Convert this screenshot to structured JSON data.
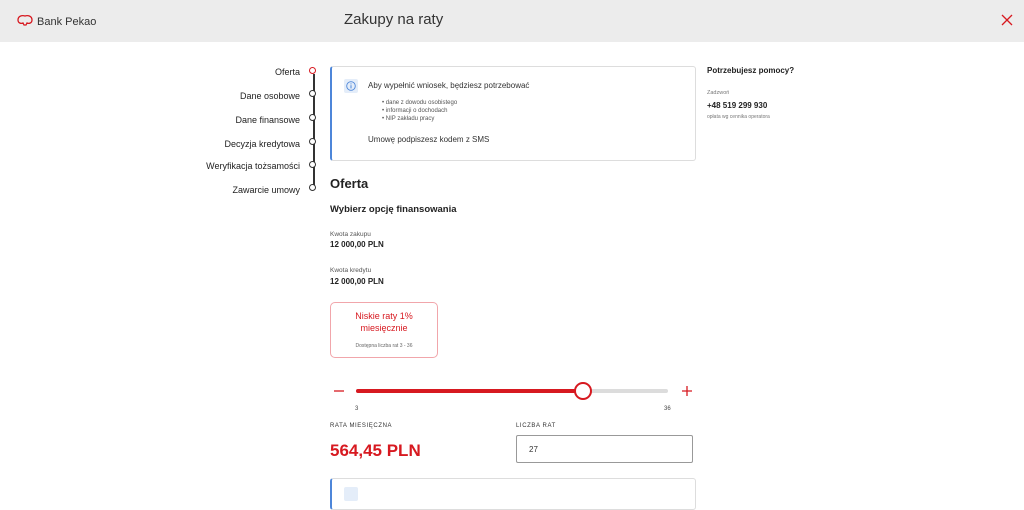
{
  "header": {
    "brand": "Bank Pekao",
    "title": "Zakupy na raty"
  },
  "colors": {
    "accent": "#d71920",
    "info": "#4d86d9",
    "header_bg": "#ececec"
  },
  "steps": [
    {
      "label": "Oferta",
      "active": true
    },
    {
      "label": "Dane osobowe",
      "active": false
    },
    {
      "label": "Dane finansowe",
      "active": false
    },
    {
      "label": "Decyzja kredytowa",
      "active": false
    },
    {
      "label": "Weryfikacja tożsamości",
      "active": false
    },
    {
      "label": "Zawarcie umowy",
      "active": false
    }
  ],
  "info": {
    "title": "Aby wypełnić wniosek, będziesz potrzebować",
    "items": [
      "dane z dowodu osobistego",
      "informacji o dochodach",
      "NIP zakładu pracy"
    ],
    "footer": "Umowę podpiszesz kodem z SMS"
  },
  "offer": {
    "title": "Oferta",
    "subtitle": "Wybierz opcję finansowania",
    "purchase_label": "Kwota zakupu",
    "purchase_value": "12 000,00 PLN",
    "credit_label": "Kwota kredytu",
    "credit_value": "12 000,00 PLN"
  },
  "option": {
    "title_line1": "Niskie raty 1%",
    "title_line2": "miesięcznie",
    "subtitle": "Dostępna liczba rat 3 - 36"
  },
  "slider": {
    "min": 3,
    "max": 36,
    "value": 27,
    "min_label": "3",
    "max_label": "36"
  },
  "payment": {
    "monthly_label": "RATA MIESIĘCZNA",
    "monthly_value": "564,45 PLN",
    "count_label": "LICZBA RAT",
    "count_value": "27"
  },
  "help": {
    "title": "Potrzebujesz pomocy?",
    "call_label": "Zadzwoń",
    "phone": "+48 519 299 930",
    "note": "opłata wg cennika operatora"
  }
}
